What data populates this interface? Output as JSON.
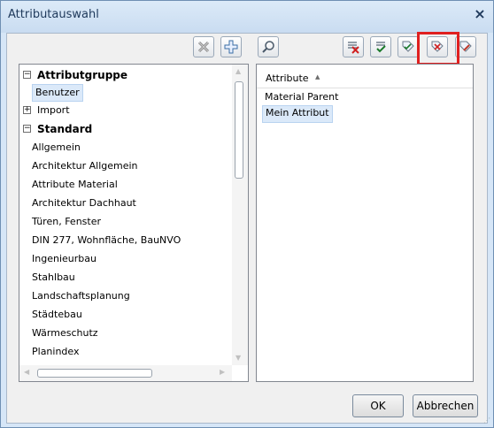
{
  "window": {
    "title": "Attributauswahl",
    "close_glyph": "×"
  },
  "toolbar": {
    "icons": [
      "delete-icon",
      "add-icon",
      "search-icon",
      "deselect-all-icon",
      "select-all-icon",
      "tag-check-icon",
      "tag-cross-icon",
      "tag-pencil-icon"
    ]
  },
  "tree": {
    "groups": [
      {
        "label": "Attributgruppe",
        "expanded": true,
        "items": [
          "Benutzer"
        ]
      },
      {
        "label": "Import",
        "expanded": false,
        "items": []
      },
      {
        "label": "Standard",
        "expanded": true,
        "items": [
          "Allgemein",
          "Architektur Allgemein",
          "Attribute Material",
          "Architektur Dachhaut",
          "Türen, Fenster",
          "DIN 277, Wohnfläche, BauNVO",
          "Ingenieurbau",
          "Stahlbau",
          "Landschaftsplanung",
          "Städtebau",
          "Wärmeschutz",
          "Planindex"
        ]
      }
    ],
    "selected": "Benutzer",
    "expand_minus": "−",
    "expand_plus": "+"
  },
  "attributes": {
    "column_header": "Attribute",
    "items": [
      "Material Parent",
      "Mein Attribut"
    ],
    "selected": "Mein Attribut"
  },
  "buttons": {
    "ok": "OK",
    "cancel": "Abbrechen"
  },
  "colors": {
    "highlight": "#e02020",
    "selection": "#dbe9f9"
  }
}
